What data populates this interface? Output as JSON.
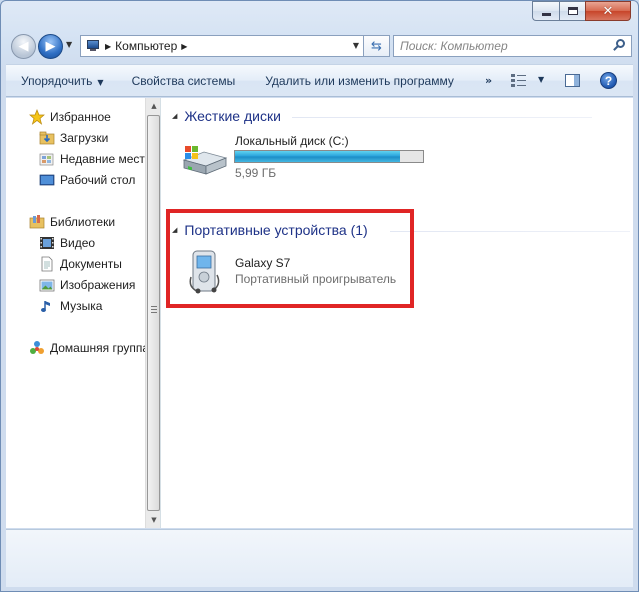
{
  "window": {
    "caption_buttons": {
      "minimize": "minimize",
      "maximize": "maximize",
      "close": "✕"
    }
  },
  "address_bar": {
    "breadcrumb": "Компьютер",
    "search_placeholder": "Поиск: Компьютер"
  },
  "command_bar": {
    "organize": "Упорядочить",
    "system_properties": "Свойства системы",
    "uninstall": "Удалить или изменить программу",
    "more": "»"
  },
  "nav_pane": {
    "favorites": {
      "label": "Избранное",
      "items": [
        {
          "label": "Загрузки",
          "icon": "downloads-folder-icon"
        },
        {
          "label": "Недавние места",
          "icon": "recent-places-icon"
        },
        {
          "label": "Рабочий стол",
          "icon": "desktop-icon"
        }
      ]
    },
    "libraries": {
      "label": "Библиотеки",
      "items": [
        {
          "label": "Видео",
          "icon": "video-icon"
        },
        {
          "label": "Документы",
          "icon": "documents-icon"
        },
        {
          "label": "Изображения",
          "icon": "pictures-icon"
        },
        {
          "label": "Музыка",
          "icon": "music-icon"
        }
      ]
    },
    "homegroup": {
      "label": "Домашняя группа"
    }
  },
  "main": {
    "hard_drives": {
      "header": "Жесткие диски",
      "drive": {
        "name": "Локальный диск (C:)",
        "size": "5,99 ГБ",
        "usage_fraction": 0.88
      }
    },
    "portable_devices": {
      "header": "Портативные устройства (1)",
      "device": {
        "name": "Galaxy S7",
        "type": "Портативный проигрыватель"
      }
    }
  },
  "colors": {
    "group_header": "#1e3287",
    "highlight_box": "#e02525",
    "drive_bar": "#26a0da"
  }
}
